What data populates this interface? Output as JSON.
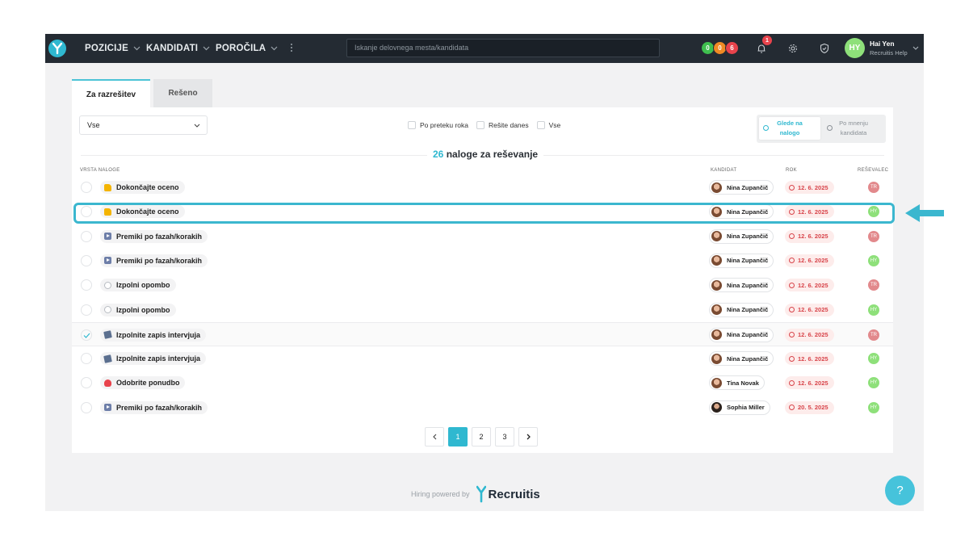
{
  "topbar": {
    "nav": [
      {
        "label": "POZICIJE"
      },
      {
        "label": "KANDIDATI"
      },
      {
        "label": "POROČILA"
      }
    ],
    "search_placeholder": "Iskanje delovnega mesta/kandidata",
    "counters": [
      {
        "value": "0",
        "color": "#3fbf4f"
      },
      {
        "value": "0",
        "color": "#f08a24"
      },
      {
        "value": "6",
        "color": "#e8434c"
      }
    ],
    "notifications_badge": "1",
    "user": {
      "initials": "HY",
      "name": "Hai Yen",
      "subtitle": "Recruitis Help"
    }
  },
  "tabs": [
    {
      "label": "Za razrešitev",
      "active": true
    },
    {
      "label": "Rešeno",
      "active": false
    }
  ],
  "filter_select": {
    "value": "Vse"
  },
  "checkbox_filters": [
    {
      "label": "Po preteku roka"
    },
    {
      "label": "Rešite danes"
    },
    {
      "label": "Vse"
    }
  ],
  "view_toggle": {
    "on_line1": "Glede na",
    "on_line2": "nalogo",
    "off_line1": "Po mnenju",
    "off_line2": "kandidata"
  },
  "summary": {
    "count": "26",
    "text": "naloge za reševanje"
  },
  "columns": {
    "task_type": "VRSTA NALOGE",
    "candidate": "KANDIDAT",
    "due": "ROK",
    "assignee": "REŠEVALEC"
  },
  "tasks": [
    {
      "icon": "thumbs-up-icon",
      "label": "Dokončajte oceno",
      "candidate": "Nina Zupančič",
      "due": "12. 6. 2025",
      "assignee": "TR"
    },
    {
      "icon": "thumbs-up-icon",
      "label": "Dokončajte oceno",
      "candidate": "Nina Zupančič",
      "due": "12. 6. 2025",
      "assignee": "HY"
    },
    {
      "icon": "play-icon",
      "label": "Premiki po fazah/korakih",
      "candidate": "Nina Zupančič",
      "due": "12. 6. 2025",
      "assignee": "TR"
    },
    {
      "icon": "play-icon",
      "label": "Premiki po fazah/korakih",
      "candidate": "Nina Zupančič",
      "due": "12. 6. 2025",
      "assignee": "HY"
    },
    {
      "icon": "speech-bubble-icon",
      "label": "Izpolni opombo",
      "candidate": "Nina Zupančič",
      "due": "12. 6. 2025",
      "assignee": "TR"
    },
    {
      "icon": "speech-bubble-icon",
      "label": "Izpolni opombo",
      "candidate": "Nina Zupančič",
      "due": "12. 6. 2025",
      "assignee": "HY"
    },
    {
      "icon": "note-icon",
      "label": "Izpolnite zapis intervjuja",
      "candidate": "Nina Zupančič",
      "due": "12. 6. 2025",
      "assignee": "TR"
    },
    {
      "icon": "note-icon",
      "label": "Izpolnite zapis intervjuja",
      "candidate": "Nina Zupančič",
      "due": "12. 6. 2025",
      "assignee": "HY"
    },
    {
      "icon": "hot-springs-icon",
      "label": "Odobrite ponudbo",
      "candidate": "Tina Novak",
      "due": "12. 6. 2025",
      "assignee": "HY"
    },
    {
      "icon": "play-icon",
      "label": "Premiki po fazah/korakih",
      "candidate": "Sophia Miller",
      "due": "20. 5. 2025",
      "assignee": "HY"
    }
  ],
  "pagination": {
    "pages": [
      "1",
      "2",
      "3"
    ],
    "current": "1"
  },
  "footer": {
    "powered_by": "Hiring powered by",
    "brand": "Recruitis"
  },
  "help_button": "?"
}
